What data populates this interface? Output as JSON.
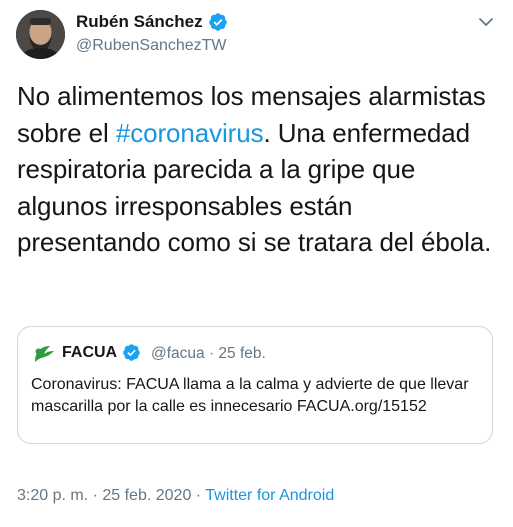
{
  "author": {
    "display_name": "Rubén Sánchez",
    "handle": "@RubenSanchezTW",
    "verified_icon": "verified-badge-icon"
  },
  "tweet": {
    "text_before": "No alimentemos los mensajes alarmistas sobre el ",
    "hashtag": "#coronavirus",
    "text_after": ". Una enfermedad respiratoria parecida a la gripe que algunos irresponsables están presentando como si se tratara del ébola."
  },
  "quoted_tweet": {
    "name": "FACUA",
    "handle_date": "@facua · 25 feb.",
    "text": "Coronavirus: FACUA llama a la calma y advierte de que llevar mascarilla por la calle es innecesario FACUA.org/15152"
  },
  "meta": {
    "timestamp": "3:20 p. m. · 25 feb. 2020 · ",
    "source": "Twitter for Android"
  },
  "colors": {
    "link": "#1b95e0",
    "secondary": "#657786",
    "border": "#ccd6dd",
    "facua_green": "#2e9b3c"
  }
}
